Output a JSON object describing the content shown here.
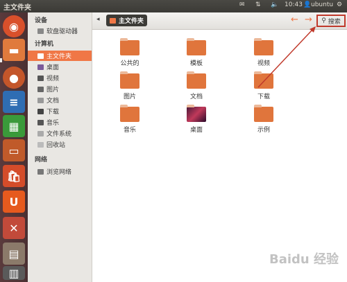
{
  "topbar": {
    "title": "主文件夹",
    "time": "10:43",
    "user": "ubuntu"
  },
  "sidebar": {
    "sections": [
      {
        "label": "设备",
        "items": [
          {
            "label": "软盘驱动器",
            "icon": "floppy-icon"
          }
        ]
      },
      {
        "label": "计算机",
        "items": [
          {
            "label": "主文件夹",
            "icon": "home-folder-icon"
          },
          {
            "label": "桌面",
            "icon": "desktop-icon"
          },
          {
            "label": "视频",
            "icon": "video-icon"
          },
          {
            "label": "图片",
            "icon": "pictures-icon"
          },
          {
            "label": "文档",
            "icon": "documents-icon"
          },
          {
            "label": "下载",
            "icon": "downloads-icon"
          },
          {
            "label": "音乐",
            "icon": "music-icon"
          },
          {
            "label": "文件系统",
            "icon": "filesystem-icon"
          },
          {
            "label": "回收站",
            "icon": "trash-icon"
          }
        ]
      },
      {
        "label": "网络",
        "items": [
          {
            "label": "浏览网络",
            "icon": "network-icon"
          }
        ]
      }
    ]
  },
  "toolbar": {
    "breadcrumb": "主文件夹",
    "search_label": "搜索"
  },
  "folders": [
    {
      "label": "公共的"
    },
    {
      "label": "模板"
    },
    {
      "label": "视频"
    },
    {
      "label": "图片"
    },
    {
      "label": "文档"
    },
    {
      "label": "下载"
    },
    {
      "label": "音乐"
    },
    {
      "label": "桌面"
    },
    {
      "label": "示例"
    }
  ],
  "watermark": "Baidu 经验",
  "colors": {
    "accent": "#f07746",
    "annotation": "#c0392b"
  }
}
